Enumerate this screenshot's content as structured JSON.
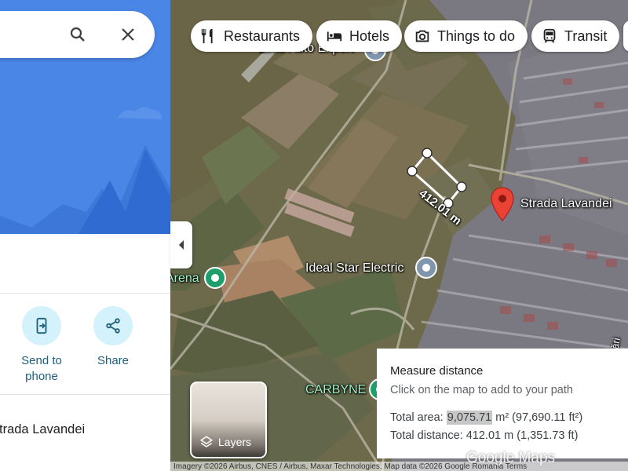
{
  "chips": [
    {
      "label": "Restaurants",
      "icon": "restaurant-icon"
    },
    {
      "label": "Hotels",
      "icon": "hotel-icon"
    },
    {
      "label": "Things to do",
      "icon": "camera-icon"
    },
    {
      "label": "Transit",
      "icon": "train-icon"
    }
  ],
  "map_labels": {
    "top_business": "Limo Auto Export",
    "place_pin": "Strada Lavandei",
    "business": "Ideal Star Electric",
    "arena": "Arena",
    "carbyne": "CARBYNE",
    "measure_segment": "412.01 m",
    "street_edge": "ări"
  },
  "measure": {
    "title": "Measure distance",
    "hint": "Click on the map to add to your path",
    "area_label": "Total area:",
    "area_value": "9,075.71",
    "area_rest": "m² (97,690.11 ft²)",
    "distance_label": "Total distance:",
    "distance_value": "412.01 m (1,351.73 ft)"
  },
  "layers_label": "Layers",
  "attribution": "Imagery ©2026 Airbus, CNES / Airbus, Maxar Technologies, Map data ©2026 Google   Romania   Terms",
  "logo": "Google Maps",
  "side_panel": {
    "actions": [
      {
        "label": "Send to phone",
        "icon": "send-to-phone-icon"
      },
      {
        "label": "Share",
        "icon": "share-icon"
      }
    ],
    "address": "Strada Lavandei"
  },
  "colors": {
    "panel_hero": "#4a86e6",
    "red_pin": "#ea4335",
    "action_circle": "#d3f2fb",
    "action_text": "#1f5f7a"
  }
}
